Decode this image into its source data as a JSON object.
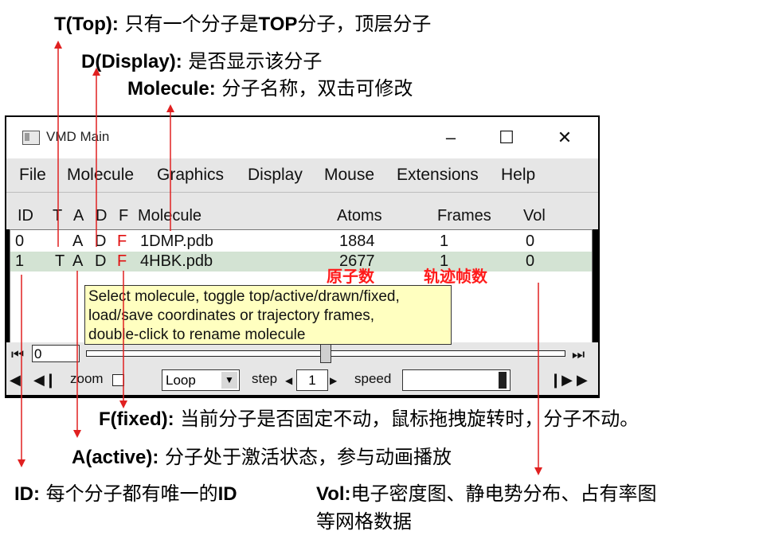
{
  "annotations": {
    "top": {
      "key": "T(Top):",
      "desc": " 只有一个分子是",
      "strong": "TOP",
      "desc2": "分子，顶层分子"
    },
    "display": {
      "key": "D(Display):",
      "desc": " 是否显示该分子"
    },
    "molecule": {
      "key": "Molecule:",
      "desc": " 分子名称，双击可修改"
    },
    "fixed": {
      "key": "F(fixed):",
      "desc": " 当前分子是否固定不动，鼠标拖拽旋转时，分子不动。"
    },
    "active": {
      "key": "A(active):",
      "desc": " 分子处于激活状态，参与动画播放"
    },
    "id": {
      "key": "ID:",
      "desc": " 每个分子都有唯一的",
      "strong": "ID"
    },
    "vol": {
      "key": "Vol:",
      "desc": "电子密度图、静电势分布、占有率图",
      "desc_line2": "等网格数据"
    },
    "atoms_note": "原子数",
    "frames_note": "轨迹帧数"
  },
  "window": {
    "title": "VMD Main",
    "minimize": "–",
    "maximize": "☐",
    "close": "✕"
  },
  "menu": [
    "File",
    "Molecule",
    "Graphics",
    "Display",
    "Mouse",
    "Extensions",
    "Help"
  ],
  "columns": {
    "id": "ID",
    "t": "T",
    "a": "A",
    "d": "D",
    "f": "F",
    "molecule": "Molecule",
    "atoms": "Atoms",
    "frames": "Frames",
    "vol": "Vol"
  },
  "rows": [
    {
      "id": "0",
      "t": "",
      "a": "A",
      "d": "D",
      "f": "F",
      "molecule": "1DMP.pdb",
      "atoms": "1884",
      "frames": "1",
      "vol": "0",
      "selected": false
    },
    {
      "id": "1",
      "t": "T",
      "a": "A",
      "d": "D",
      "f": "F",
      "molecule": "4HBK.pdb",
      "atoms": "2677",
      "frames": "1",
      "vol": "0",
      "selected": true
    }
  ],
  "tooltip": {
    "line1": "Select molecule, toggle top/active/drawn/fixed,",
    "line2": "load/save coordinates or trajectory frames,",
    "line3": "double-click to rename molecule"
  },
  "controls": {
    "frame_value": "0",
    "zoom_label": "zoom",
    "loop_value": "Loop",
    "step_label": "step",
    "step_value": "1",
    "speed_label": "speed"
  },
  "colors": {
    "arrow": "#e02020",
    "selected_row": "#d3e3d3",
    "tooltip_bg": "#ffffc0",
    "flag_red": "#e01010"
  }
}
